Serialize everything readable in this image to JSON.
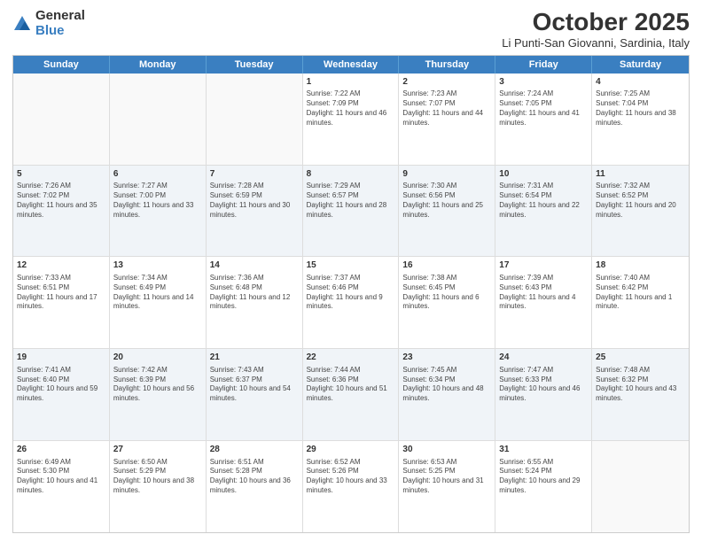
{
  "logo": {
    "text1": "General",
    "text2": "Blue"
  },
  "title": "October 2025",
  "subtitle": "Li Punti-San Giovanni, Sardinia, Italy",
  "headers": [
    "Sunday",
    "Monday",
    "Tuesday",
    "Wednesday",
    "Thursday",
    "Friday",
    "Saturday"
  ],
  "rows": [
    [
      {
        "day": "",
        "info": ""
      },
      {
        "day": "",
        "info": ""
      },
      {
        "day": "",
        "info": ""
      },
      {
        "day": "1",
        "info": "Sunrise: 7:22 AM\nSunset: 7:09 PM\nDaylight: 11 hours and 46 minutes."
      },
      {
        "day": "2",
        "info": "Sunrise: 7:23 AM\nSunset: 7:07 PM\nDaylight: 11 hours and 44 minutes."
      },
      {
        "day": "3",
        "info": "Sunrise: 7:24 AM\nSunset: 7:05 PM\nDaylight: 11 hours and 41 minutes."
      },
      {
        "day": "4",
        "info": "Sunrise: 7:25 AM\nSunset: 7:04 PM\nDaylight: 11 hours and 38 minutes."
      }
    ],
    [
      {
        "day": "5",
        "info": "Sunrise: 7:26 AM\nSunset: 7:02 PM\nDaylight: 11 hours and 35 minutes."
      },
      {
        "day": "6",
        "info": "Sunrise: 7:27 AM\nSunset: 7:00 PM\nDaylight: 11 hours and 33 minutes."
      },
      {
        "day": "7",
        "info": "Sunrise: 7:28 AM\nSunset: 6:59 PM\nDaylight: 11 hours and 30 minutes."
      },
      {
        "day": "8",
        "info": "Sunrise: 7:29 AM\nSunset: 6:57 PM\nDaylight: 11 hours and 28 minutes."
      },
      {
        "day": "9",
        "info": "Sunrise: 7:30 AM\nSunset: 6:56 PM\nDaylight: 11 hours and 25 minutes."
      },
      {
        "day": "10",
        "info": "Sunrise: 7:31 AM\nSunset: 6:54 PM\nDaylight: 11 hours and 22 minutes."
      },
      {
        "day": "11",
        "info": "Sunrise: 7:32 AM\nSunset: 6:52 PM\nDaylight: 11 hours and 20 minutes."
      }
    ],
    [
      {
        "day": "12",
        "info": "Sunrise: 7:33 AM\nSunset: 6:51 PM\nDaylight: 11 hours and 17 minutes."
      },
      {
        "day": "13",
        "info": "Sunrise: 7:34 AM\nSunset: 6:49 PM\nDaylight: 11 hours and 14 minutes."
      },
      {
        "day": "14",
        "info": "Sunrise: 7:36 AM\nSunset: 6:48 PM\nDaylight: 11 hours and 12 minutes."
      },
      {
        "day": "15",
        "info": "Sunrise: 7:37 AM\nSunset: 6:46 PM\nDaylight: 11 hours and 9 minutes."
      },
      {
        "day": "16",
        "info": "Sunrise: 7:38 AM\nSunset: 6:45 PM\nDaylight: 11 hours and 6 minutes."
      },
      {
        "day": "17",
        "info": "Sunrise: 7:39 AM\nSunset: 6:43 PM\nDaylight: 11 hours and 4 minutes."
      },
      {
        "day": "18",
        "info": "Sunrise: 7:40 AM\nSunset: 6:42 PM\nDaylight: 11 hours and 1 minute."
      }
    ],
    [
      {
        "day": "19",
        "info": "Sunrise: 7:41 AM\nSunset: 6:40 PM\nDaylight: 10 hours and 59 minutes."
      },
      {
        "day": "20",
        "info": "Sunrise: 7:42 AM\nSunset: 6:39 PM\nDaylight: 10 hours and 56 minutes."
      },
      {
        "day": "21",
        "info": "Sunrise: 7:43 AM\nSunset: 6:37 PM\nDaylight: 10 hours and 54 minutes."
      },
      {
        "day": "22",
        "info": "Sunrise: 7:44 AM\nSunset: 6:36 PM\nDaylight: 10 hours and 51 minutes."
      },
      {
        "day": "23",
        "info": "Sunrise: 7:45 AM\nSunset: 6:34 PM\nDaylight: 10 hours and 48 minutes."
      },
      {
        "day": "24",
        "info": "Sunrise: 7:47 AM\nSunset: 6:33 PM\nDaylight: 10 hours and 46 minutes."
      },
      {
        "day": "25",
        "info": "Sunrise: 7:48 AM\nSunset: 6:32 PM\nDaylight: 10 hours and 43 minutes."
      }
    ],
    [
      {
        "day": "26",
        "info": "Sunrise: 6:49 AM\nSunset: 5:30 PM\nDaylight: 10 hours and 41 minutes."
      },
      {
        "day": "27",
        "info": "Sunrise: 6:50 AM\nSunset: 5:29 PM\nDaylight: 10 hours and 38 minutes."
      },
      {
        "day": "28",
        "info": "Sunrise: 6:51 AM\nSunset: 5:28 PM\nDaylight: 10 hours and 36 minutes."
      },
      {
        "day": "29",
        "info": "Sunrise: 6:52 AM\nSunset: 5:26 PM\nDaylight: 10 hours and 33 minutes."
      },
      {
        "day": "30",
        "info": "Sunrise: 6:53 AM\nSunset: 5:25 PM\nDaylight: 10 hours and 31 minutes."
      },
      {
        "day": "31",
        "info": "Sunrise: 6:55 AM\nSunset: 5:24 PM\nDaylight: 10 hours and 29 minutes."
      },
      {
        "day": "",
        "info": ""
      }
    ]
  ]
}
